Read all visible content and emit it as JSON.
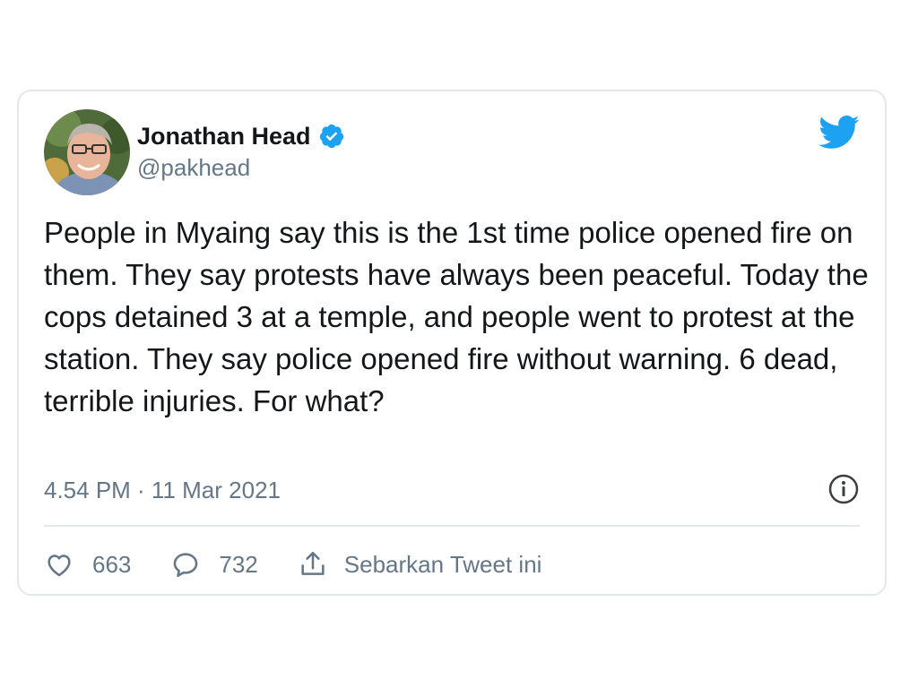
{
  "author": {
    "name": "Jonathan Head",
    "handle": "@pakhead",
    "verified": true
  },
  "tweet": {
    "text": "People in Myaing say this is the 1st time police opened fire on them. They say protests have always been peaceful. Today the cops detained 3 at a temple, and people went to protest at the station. They say police opened fire without warning. 6 dead, terrible injuries. For what?",
    "timestamp": "4.54 PM · 11 Mar 2021"
  },
  "actions": {
    "likes": "663",
    "replies": "732",
    "share_label": "Sebarkan Tweet ini"
  },
  "icons": {
    "brand": "twitter-bird-icon",
    "verified": "verified-badge-icon",
    "info": "info-icon",
    "like": "heart-icon",
    "reply": "reply-bubble-icon",
    "share": "share-icon"
  },
  "colors": {
    "accent": "#1da1f2",
    "text": "#14171a",
    "muted": "#657786",
    "border": "#e3e8ec"
  }
}
